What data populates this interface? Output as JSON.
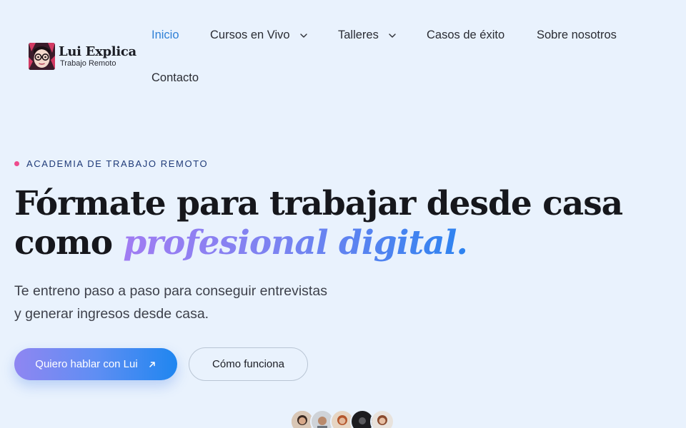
{
  "brand": {
    "name": "Lui Explica",
    "tagline": "Trabajo Remoto"
  },
  "nav": {
    "items": [
      {
        "label": "Inicio",
        "active": true,
        "has_dropdown": false
      },
      {
        "label": "Cursos en Vivo",
        "active": false,
        "has_dropdown": true
      },
      {
        "label": "Talleres",
        "active": false,
        "has_dropdown": true
      },
      {
        "label": "Casos de éxito",
        "active": false,
        "has_dropdown": false
      },
      {
        "label": "Sobre nosotros",
        "active": false,
        "has_dropdown": false
      },
      {
        "label": "Contacto",
        "active": false,
        "has_dropdown": false
      }
    ]
  },
  "hero": {
    "eyebrow": "ACADEMIA DE TRABAJO REMOTO",
    "headline_plain": "Fórmate para trabajar desde casa como ",
    "headline_highlight": "profesional digital.",
    "subtitle_line1": "Te entreno paso a paso para conseguir entrevistas",
    "subtitle_line2": "y generar ingresos desde casa.",
    "cta_primary": "Quiero hablar con Lui",
    "cta_primary_icon": "arrow-up-right-icon",
    "cta_secondary": "Cómo funciona"
  },
  "colors": {
    "background": "#e9f2fd",
    "accent": "#2f80d6",
    "eyebrow_dot": "#ee4b8d",
    "gradient_start": "#a17cf2",
    "gradient_end": "#2c83f0"
  },
  "social_proof": {
    "avatars": [
      "avatar-1",
      "avatar-2",
      "avatar-3",
      "avatar-4",
      "avatar-5"
    ]
  }
}
